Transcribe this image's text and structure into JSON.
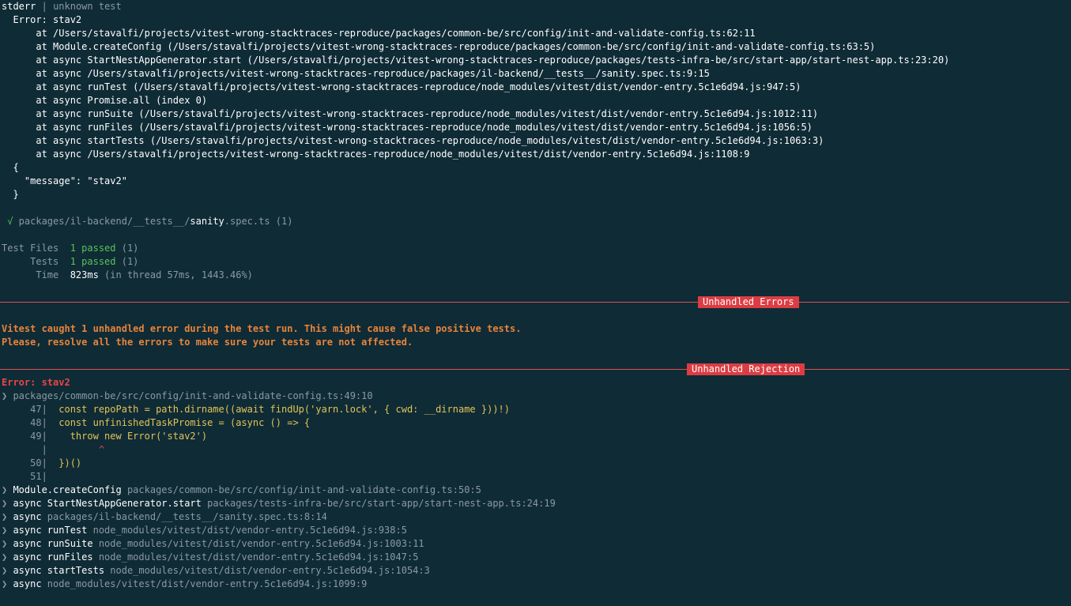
{
  "stderr_header": {
    "label": "stderr",
    "sep": "|",
    "test": "unknown test"
  },
  "error_block": {
    "title": "  Error: stav2",
    "stack": [
      "      at /Users/stavalfi/projects/vitest-wrong-stacktraces-reproduce/packages/common-be/src/config/init-and-validate-config.ts:62:11",
      "      at Module.createConfig (/Users/stavalfi/projects/vitest-wrong-stacktraces-reproduce/packages/common-be/src/config/init-and-validate-config.ts:63:5)",
      "      at async StartNestAppGenerator.start (/Users/stavalfi/projects/vitest-wrong-stacktraces-reproduce/packages/tests-infra-be/src/start-app/start-nest-app.ts:23:20)",
      "      at async /Users/stavalfi/projects/vitest-wrong-stacktraces-reproduce/packages/il-backend/__tests__/sanity.spec.ts:9:15",
      "      at async runTest (/Users/stavalfi/projects/vitest-wrong-stacktraces-reproduce/node_modules/vitest/dist/vendor-entry.5c1e6d94.js:947:5)",
      "      at async Promise.all (index 0)",
      "      at async runSuite (/Users/stavalfi/projects/vitest-wrong-stacktraces-reproduce/node_modules/vitest/dist/vendor-entry.5c1e6d94.js:1012:11)",
      "      at async runFiles (/Users/stavalfi/projects/vitest-wrong-stacktraces-reproduce/node_modules/vitest/dist/vendor-entry.5c1e6d94.js:1056:5)",
      "      at async startTests (/Users/stavalfi/projects/vitest-wrong-stacktraces-reproduce/node_modules/vitest/dist/vendor-entry.5c1e6d94.js:1063:3)",
      "      at async /Users/stavalfi/projects/vitest-wrong-stacktraces-reproduce/node_modules/vitest/dist/vendor-entry.5c1e6d94.js:1108:9"
    ],
    "json_lines": [
      "  {",
      "    \"message\": \"stav2\"",
      "  }"
    ]
  },
  "test_file": {
    "check": " √",
    "dir": " packages/il-backend/__tests__/",
    "name": "sanity",
    "ext": ".spec.ts",
    "count": " (1)"
  },
  "summary": {
    "files_label": "Test Files",
    "files_value": "  1 passed",
    "files_count": " (1)",
    "tests_label": "     Tests",
    "tests_value": "  1 passed",
    "tests_count": " (1)",
    "time_label": "      Time",
    "time_value": "  823ms",
    "time_detail": " (in thread 57ms, 1443.46%)"
  },
  "unhandled_errors": {
    "badge": "Unhandled Errors",
    "message1": "Vitest caught 1 unhandled error during the test run. This might cause false positive tests.",
    "message2": "Please, resolve all the errors to make sure your tests are not affected."
  },
  "rejection": {
    "badge": "Unhandled Rejection",
    "error": "Error: stav2",
    "location": "❯ packages/common-be/src/config/init-and-validate-config.ts:49:10",
    "code": [
      {
        "gutter": "     47|",
        "code": "  const repoPath = path.dirname((await findUp('yarn.lock', { cwd: __dirname }))!)"
      },
      {
        "gutter": "     48|",
        "code": "  const unfinishedTaskPromise = (async () => {"
      },
      {
        "gutter": "     49|",
        "code": "    throw new Error('stav2')"
      },
      {
        "gutter": "       |",
        "code": "         ^"
      },
      {
        "gutter": "     50|",
        "code": "  })()"
      },
      {
        "gutter": "     51|",
        "code": ""
      }
    ],
    "trace": [
      {
        "arrow": "❯ ",
        "fn": "Module.createConfig",
        "loc": " packages/common-be/src/config/init-and-validate-config.ts:50:5"
      },
      {
        "arrow": "❯ ",
        "fn": "async StartNestAppGenerator.start",
        "loc": " packages/tests-infra-be/src/start-app/start-nest-app.ts:24:19"
      },
      {
        "arrow": "❯ ",
        "fn": "async",
        "loc": " packages/il-backend/__tests__/sanity.spec.ts:8:14"
      },
      {
        "arrow": "❯ ",
        "fn": "async runTest",
        "loc": " node_modules/vitest/dist/vendor-entry.5c1e6d94.js:938:5"
      },
      {
        "arrow": "❯ ",
        "fn": "async runSuite",
        "loc": " node_modules/vitest/dist/vendor-entry.5c1e6d94.js:1003:11"
      },
      {
        "arrow": "❯ ",
        "fn": "async runFiles",
        "loc": " node_modules/vitest/dist/vendor-entry.5c1e6d94.js:1047:5"
      },
      {
        "arrow": "❯ ",
        "fn": "async startTests",
        "loc": " node_modules/vitest/dist/vendor-entry.5c1e6d94.js:1054:3"
      },
      {
        "arrow": "❯ ",
        "fn": "async",
        "loc": " node_modules/vitest/dist/vendor-entry.5c1e6d94.js:1099:9"
      }
    ]
  }
}
